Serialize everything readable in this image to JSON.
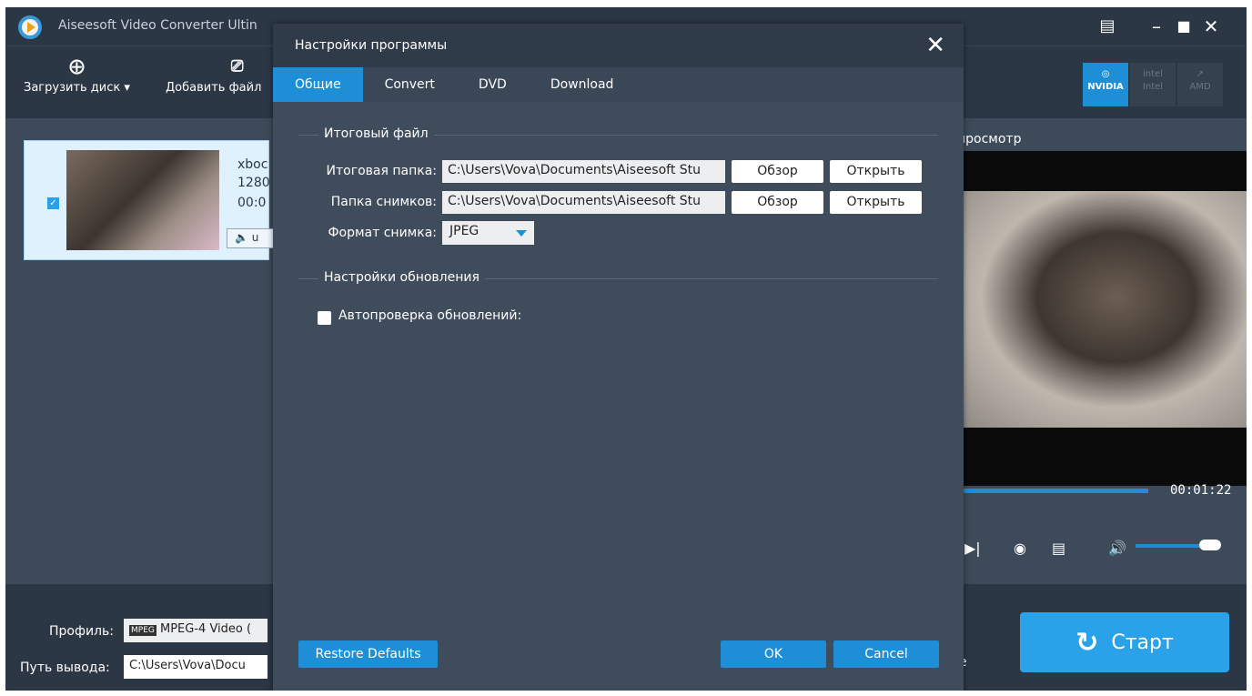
{
  "window": {
    "title": "Aiseesoft Video Converter Ultin",
    "icons": [
      "menu-icon",
      "minimize-icon",
      "maximize-icon",
      "close-icon"
    ]
  },
  "toolbar": {
    "load_disc": "Загрузить диск",
    "add_file": "Добавить файл"
  },
  "gpu": {
    "nvidia": "NVIDIA",
    "intel": "Intel",
    "amd": "AMD",
    "intel_logo": "intel"
  },
  "file": {
    "name": "xboc",
    "resolution": "1280",
    "duration": "00:0",
    "audio": "u"
  },
  "preview": {
    "label": "просмотр",
    "time": "00:01:22",
    "progress": 0.02,
    "volume": 0.9
  },
  "bottom": {
    "profile_label": "Профиль:",
    "profile_value": "MPEG-4 Video (",
    "output_label": "Путь вывода:",
    "output_value": "C:\\Users\\Vova\\Docu",
    "trailing_char": "e",
    "start": "Старт"
  },
  "dialog": {
    "title": "Настройки программы",
    "tabs": [
      "Общие",
      "Convert",
      "DVD",
      "Download"
    ],
    "active_tab": "Общие",
    "output_section": "Итоговый файл",
    "output_folder_label": "Итоговая папка:",
    "output_folder_value": "C:\\Users\\Vova\\Documents\\Aiseesoft Stu",
    "snapshot_folder_label": "Папка снимков:",
    "snapshot_folder_value": "C:\\Users\\Vova\\Documents\\Aiseesoft Stu",
    "browse": "Обзор",
    "open": "Открыть",
    "snapshot_format_label": "Формат снимка:",
    "snapshot_format_value": "JPEG",
    "update_section": "Настройки обновления",
    "auto_check_label": "Автопроверка обновлений:",
    "auto_check": false,
    "restore": "Restore Defaults",
    "ok": "OK",
    "cancel": "Cancel"
  }
}
